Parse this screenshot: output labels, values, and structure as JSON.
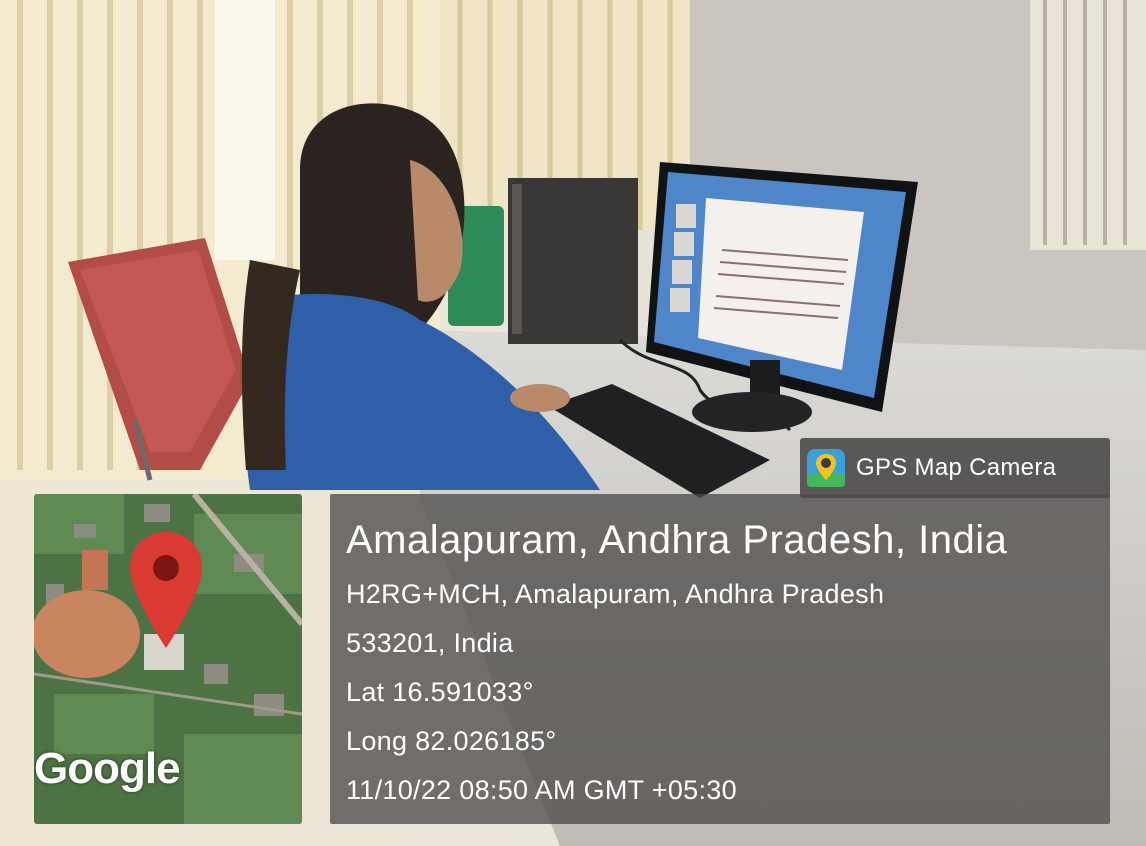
{
  "stamp": {
    "app_name": "GPS Map Camera",
    "location_title": "Amalapuram, Andhra Pradesh, India",
    "address_line1": "H2RG+MCH, Amalapuram, Andhra Pradesh",
    "address_line2": "533201, India",
    "latitude": "Lat 16.591033°",
    "longitude": "Long 82.026185°",
    "datetime": "11/10/22 08:50 AM GMT +05:30",
    "map_attribution": "Google"
  },
  "colors": {
    "pin": "#d93a32",
    "overlay": "#4e4c4a",
    "map_green": "#3f6a3a",
    "ground": "#c9865e"
  },
  "icons": {
    "badge_icon": "map-pin-camera-icon",
    "map_pin": "map-pin-icon"
  }
}
